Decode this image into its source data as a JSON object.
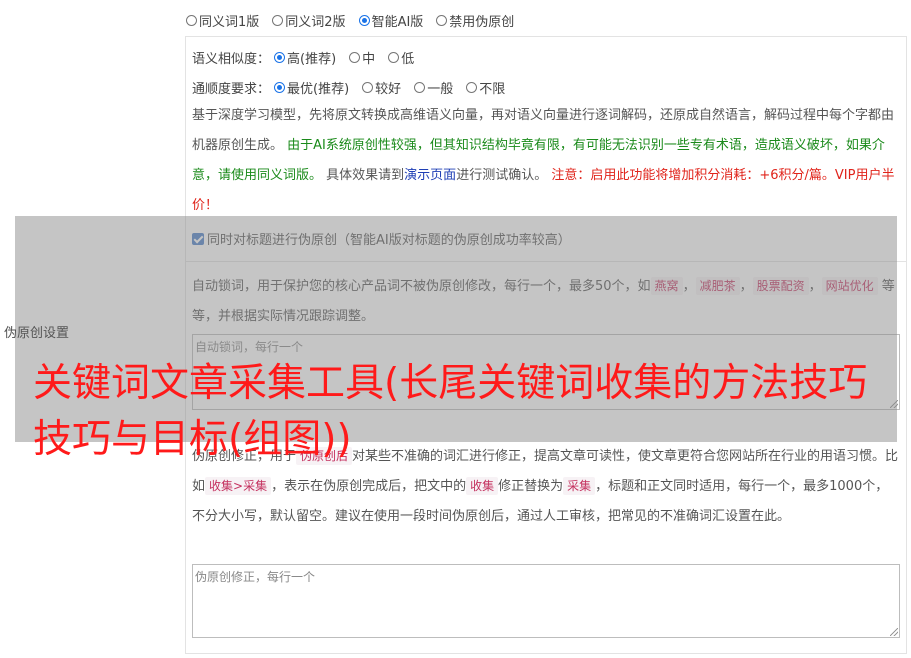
{
  "version_options": [
    {
      "label": "同义词1版",
      "checked": false
    },
    {
      "label": "同义词2版",
      "checked": false
    },
    {
      "label": "智能AI版",
      "checked": true
    },
    {
      "label": "禁用伪原创",
      "checked": false
    }
  ],
  "similarity": {
    "label": "语义相似度：",
    "options": [
      {
        "label": "高(推荐)",
        "checked": true
      },
      {
        "label": "中",
        "checked": false
      },
      {
        "label": "低",
        "checked": false
      }
    ]
  },
  "fluency": {
    "label": "通顺度要求：",
    "options": [
      {
        "label": "最优(推荐)",
        "checked": true
      },
      {
        "label": "较好",
        "checked": false
      },
      {
        "label": "一般",
        "checked": false
      },
      {
        "label": "不限",
        "checked": false
      }
    ]
  },
  "description": {
    "part1": "基于深度学习模型，先将原文转换成高维语义向量，再对语义向量进行逐词解码，还原成自然语言，解码过程中每个字都由机器原创生成。",
    "part2_green": "由于AI系统原创性较强，但其知识结构毕竟有限，有可能无法识别一些专有术语，造成语义破坏，如果介意，请使用同义词版。",
    "part3": "具体效果请到",
    "demo_link": "演示页面",
    "part4": "进行测试确认。",
    "part5_red": "注意：启用此功能将增加积分消耗：+6积分/篇。VIP用户半价！"
  },
  "title_checkbox": {
    "label": "同时对标题进行伪原创（智能AI版对标题的伪原创成功率较高）",
    "checked": true
  },
  "lock_words": {
    "text1": "自动锁词，用于保护您的核心产品词不被伪原创修改，每行一个，最多50个，如",
    "tags": [
      "燕窝",
      "减肥茶",
      "股票配资",
      "网站优化"
    ],
    "sep": "，",
    "text2": "等等，并根据实际情况跟踪调整。",
    "placeholder": "自动锁词，每行一个"
  },
  "side_label": "伪原创设置",
  "correction": {
    "text1": "伪原创修正，用于",
    "tag1": "伪原创后",
    "text2": "对某些不准确的词汇进行修正，提高文章可读性，使文章更符合您网站所在行业的用语习惯。比如",
    "tag2": "收集>采集",
    "text3": "，表示在伪原创完成后，把文中的",
    "tag3": "收集",
    "text4": "修正替换为",
    "tag4": "采集",
    "text5": "，标题和正文同时适用，每行一个，最多1000个，不分大小写，默认留空。建议在使用一段时间伪原创后，通过人工审核，把常见的不准确词汇设置在此。",
    "placeholder": "伪原创修正，每行一个"
  },
  "overlay_title": "关键词文章采集工具(长尾关键词收集的方法技巧技巧与目标(组图))",
  "colors": {
    "accent": "#1a73e8",
    "green_text": "#1a8a1a",
    "red_text": "#e0241b",
    "overlay_title": "#ff1a1a"
  }
}
